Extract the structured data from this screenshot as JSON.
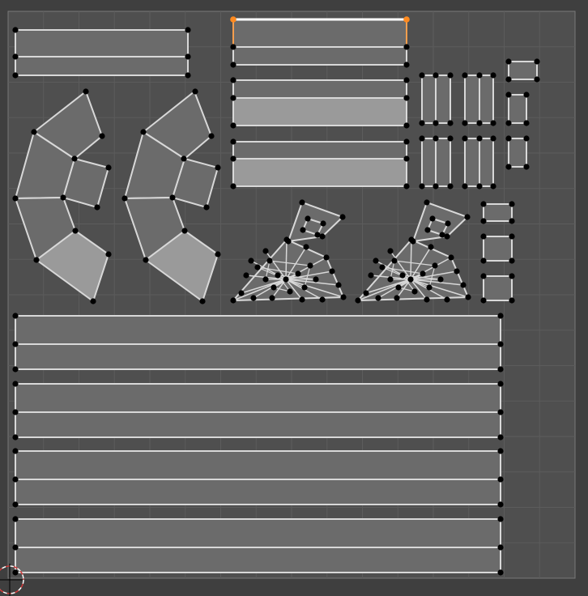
{
  "editor": {
    "colors": {
      "background": "#3f3f3f",
      "uv_space": "#4f4f4f",
      "grid_line": "#5c5c5c",
      "border": "#7a7a7a",
      "face_fill": "#6b6b6b",
      "face_fill_selected": "#9a9a9a",
      "edge": "#d8d8d8",
      "vertex": "#000000",
      "active_edge": "#ffffff",
      "active_vertex": "#ff8a1f",
      "cursor_red": "#d23a3a",
      "cursor_white": "#ffffff"
    },
    "icons": {
      "cursor": "2d-cursor-icon"
    }
  }
}
